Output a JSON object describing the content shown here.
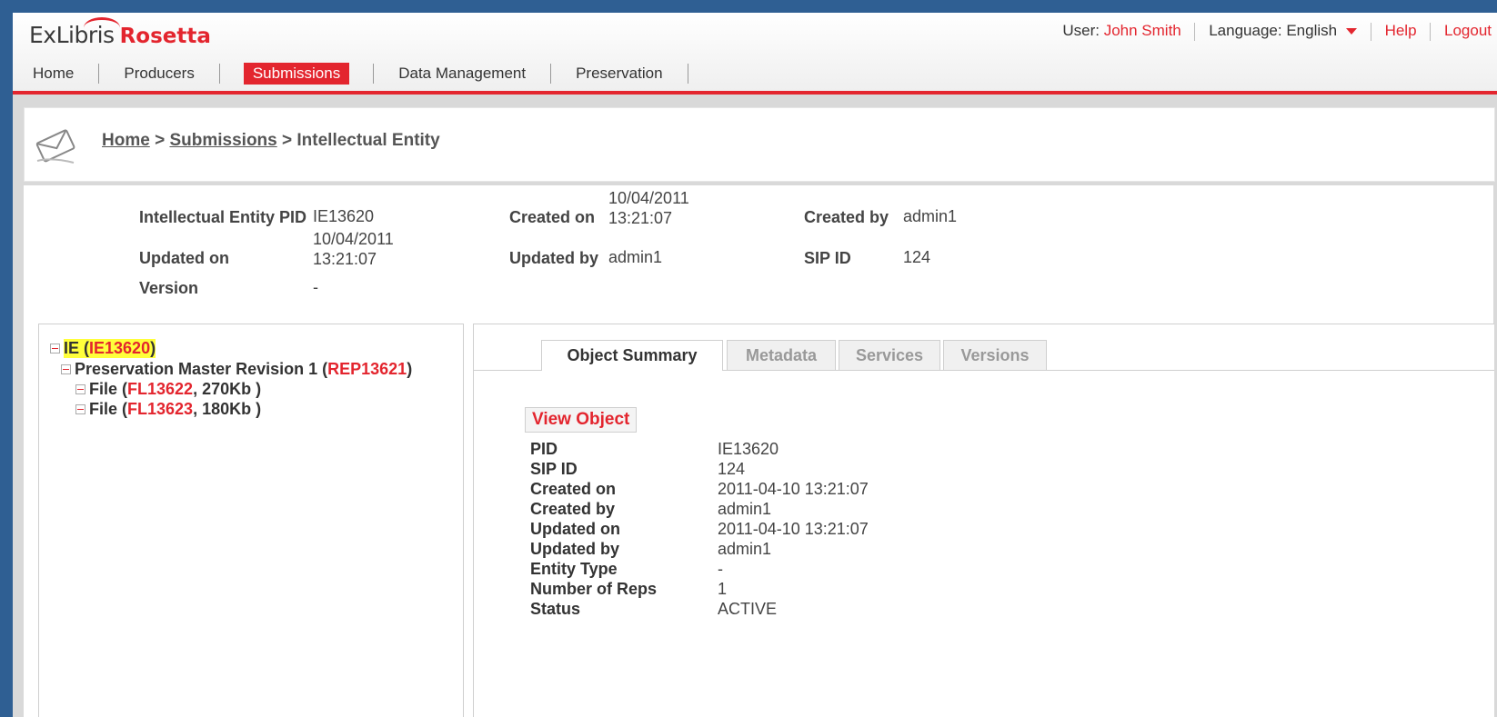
{
  "brand": {
    "logo_ex": "ExLibris",
    "logo_product": "Rosetta",
    "accent": "#e3252e"
  },
  "userbar": {
    "user_label": "User:",
    "user_name": "John Smith",
    "language_label": "Language:",
    "language_value": "English",
    "help": "Help",
    "logout": "Logout"
  },
  "nav": {
    "home": "Home",
    "producers": "Producers",
    "submissions": "Submissions",
    "data_management": "Data Management",
    "preservation": "Preservation"
  },
  "breadcrumb": {
    "home": "Home",
    "sep1": ">",
    "submissions": "Submissions",
    "sep2": ">",
    "current": "Intellectual Entity"
  },
  "properties": {
    "ie_pid_label": "Intellectual Entity PID",
    "ie_pid_value": "IE13620",
    "created_on_label": "Created on",
    "created_on_date": "10/04/2011",
    "created_on_time": "13:21:07",
    "created_by_label": "Created by",
    "created_by_value": "admin1",
    "updated_on_label": "Updated on",
    "updated_on_date": "10/04/2011",
    "updated_on_time": "13:21:07",
    "updated_by_label": "Updated by",
    "updated_by_value": "admin1",
    "sip_id_label": "SIP ID",
    "sip_id_value": "124",
    "version_label": "Version",
    "version_value": "-"
  },
  "tree": {
    "ie": {
      "prefix": "IE (",
      "pid": "IE13620",
      "suffix": ")"
    },
    "rep": {
      "prefix": "Preservation Master Revision 1 (",
      "pid": "REP13621",
      "suffix": ")"
    },
    "files": [
      {
        "prefix": "File (",
        "pid": "FL13622",
        "suffix": ", 270Kb )"
      },
      {
        "prefix": "File (",
        "pid": "FL13623",
        "suffix": ", 180Kb )"
      }
    ]
  },
  "tabs": {
    "summary": "Object Summary",
    "metadata": "Metadata",
    "services": "Services",
    "versions": "Versions"
  },
  "summary": {
    "view_object": "View Object",
    "rows": [
      {
        "k": "PID",
        "v": "IE13620"
      },
      {
        "k": "SIP ID",
        "v": "124"
      },
      {
        "k": "Created on",
        "v": "2011-04-10 13:21:07"
      },
      {
        "k": "Created by",
        "v": "admin1"
      },
      {
        "k": "Updated on",
        "v": "2011-04-10 13:21:07"
      },
      {
        "k": "Updated by",
        "v": "admin1"
      },
      {
        "k": "Entity Type",
        "v": "-"
      },
      {
        "k": "Number of Reps",
        "v": "1"
      },
      {
        "k": "Status",
        "v": "ACTIVE"
      }
    ]
  }
}
